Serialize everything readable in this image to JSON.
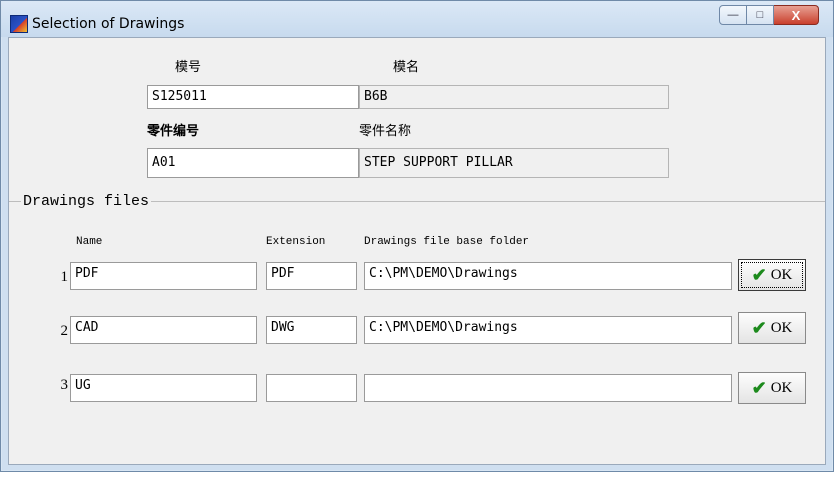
{
  "window": {
    "title": "Selection of Drawings",
    "buttons": {
      "minimize": "—",
      "maximize": "□",
      "close": "X"
    }
  },
  "header": {
    "model_no_label": "模号",
    "model_no_value": "S125011",
    "model_name_label": "模名",
    "model_name_value": "B6B",
    "part_no_label": "零件编号",
    "part_no_value": "A01",
    "part_name_label": "零件名称",
    "part_name_value": "STEP SUPPORT PILLAR"
  },
  "drawings": {
    "group_title": "Drawings files",
    "col_name": "Name",
    "col_extension": "Extension",
    "col_folder": "Drawings file base folder",
    "rows": [
      {
        "num": "1",
        "name": "PDF",
        "ext": "PDF",
        "folder": "C:\\PM\\DEMO\\Drawings",
        "ok": "OK"
      },
      {
        "num": "2",
        "name": "CAD",
        "ext": "DWG",
        "folder": "C:\\PM\\DEMO\\Drawings",
        "ok": "OK"
      },
      {
        "num": "3",
        "name": "UG",
        "ext": "",
        "folder": "",
        "ok": "OK"
      }
    ]
  },
  "icons": {
    "app": "app-icon",
    "check": "check-icon"
  }
}
